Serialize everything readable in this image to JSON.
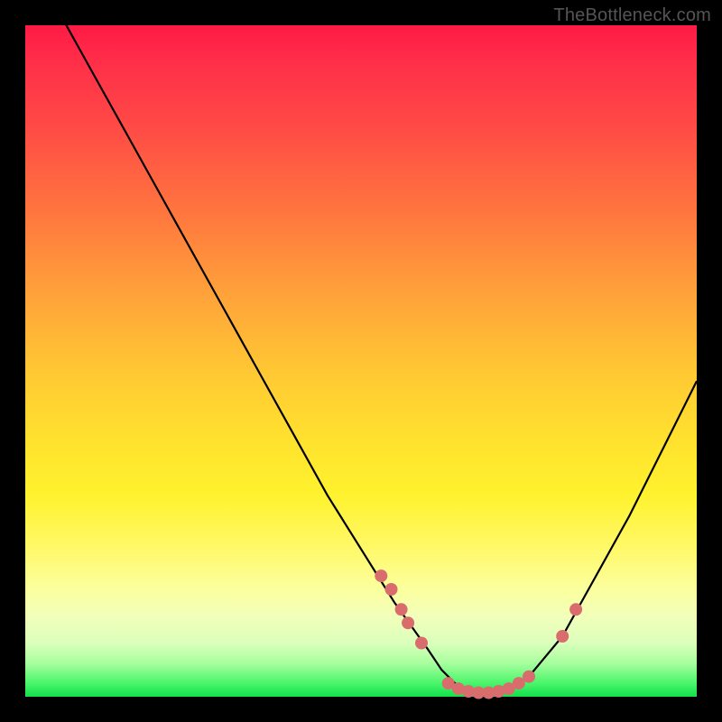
{
  "watermark": "TheBottleneck.com",
  "chart_data": {
    "type": "line",
    "title": "",
    "xlabel": "",
    "ylabel": "",
    "xlim": [
      0,
      100
    ],
    "ylim": [
      0,
      100
    ],
    "grid": false,
    "series": [
      {
        "name": "curve",
        "x": [
          0,
          5,
          10,
          15,
          20,
          25,
          30,
          35,
          40,
          45,
          50,
          55,
          60,
          62,
          64,
          66,
          68,
          70,
          72,
          75,
          80,
          85,
          90,
          95,
          100
        ],
        "values": [
          110,
          102,
          93,
          84,
          75,
          66,
          57,
          48,
          39,
          30,
          22,
          14,
          7,
          4,
          2,
          1,
          0.5,
          0.5,
          1,
          3,
          9,
          18,
          27,
          37,
          47
        ]
      }
    ],
    "markers": {
      "name": "dots",
      "color": "#d96d6d",
      "x": [
        53,
        54.5,
        56,
        57,
        59,
        63,
        64.5,
        66,
        67.5,
        69,
        70.5,
        72,
        73.5,
        75,
        80,
        82
      ],
      "values": [
        18,
        16,
        13,
        11,
        8,
        2,
        1.2,
        0.8,
        0.6,
        0.6,
        0.8,
        1.2,
        2,
        3,
        9,
        13
      ]
    }
  }
}
